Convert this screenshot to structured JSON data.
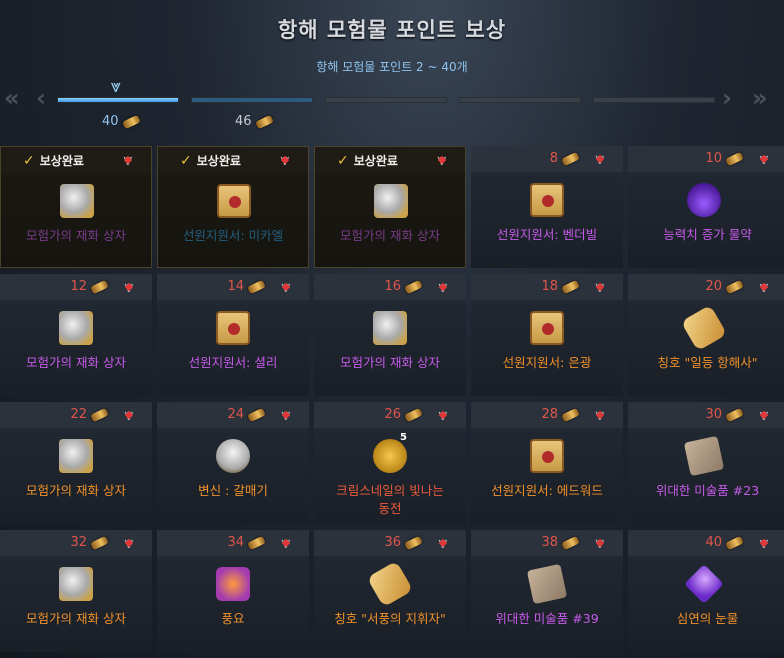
{
  "header": {
    "title": "항해 모험물 포인트 보상",
    "subtitle": "항해 모험물 포인트 2 ~ 40개"
  },
  "progress": {
    "stages": [
      {
        "points": "40",
        "fill_fraction": 1.0
      },
      {
        "points": "46",
        "fill_fraction": 1.0
      },
      {
        "points": "",
        "fill_fraction": 0
      },
      {
        "points": "",
        "fill_fraction": 0
      },
      {
        "points": "",
        "fill_fraction": 0
      }
    ]
  },
  "colors": {
    "purple": "#c65bea",
    "blue": "#2e9ad8",
    "orange": "#f0912a",
    "points_red": "#e0564a",
    "done_check": "#e8c13a"
  },
  "rewards": [
    {
      "status": "보상완료",
      "points": "",
      "icon": "chest-icon",
      "name": "모험가의 재화 상자",
      "color": "purple",
      "done": true
    },
    {
      "status": "보상완료",
      "points": "",
      "icon": "book-icon",
      "name": "선원지원서: 미카엘",
      "color": "blue",
      "done": true
    },
    {
      "status": "보상완료",
      "points": "",
      "icon": "chest-icon",
      "name": "모험가의 재화 상자",
      "color": "purple",
      "done": true
    },
    {
      "status": "",
      "points": "8",
      "icon": "book-icon",
      "name": "선원지원서: 벤더빌",
      "color": "purple",
      "done": false
    },
    {
      "status": "",
      "points": "10",
      "icon": "potion-icon",
      "name": "능력치 증가 물약",
      "color": "purple",
      "done": false
    },
    {
      "status": "",
      "points": "12",
      "icon": "chest-icon",
      "name": "모험가의 재화 상자",
      "color": "purple",
      "done": false
    },
    {
      "status": "",
      "points": "14",
      "icon": "book-icon",
      "name": "선원지원서: 셜리",
      "color": "purple",
      "done": false
    },
    {
      "status": "",
      "points": "16",
      "icon": "chest-icon",
      "name": "모험가의 재화 상자",
      "color": "purple",
      "done": false
    },
    {
      "status": "",
      "points": "18",
      "icon": "book-icon",
      "name": "선원지원서: 은광",
      "color": "orange",
      "done": false
    },
    {
      "status": "",
      "points": "20",
      "icon": "scroll-icon",
      "name": "칭호 \"일등 항해사\"",
      "color": "orange",
      "done": false
    },
    {
      "status": "",
      "points": "22",
      "icon": "chest-icon",
      "name": "모험가의 재화 상자",
      "color": "orange",
      "done": false
    },
    {
      "status": "",
      "points": "24",
      "icon": "seagull-icon",
      "name": "변신 : 갈매기",
      "color": "orange",
      "done": false
    },
    {
      "status": "",
      "points": "26",
      "icon": "coin-icon",
      "name": "크림스네일의 빛나는 동전",
      "color": "red",
      "done": false,
      "badge": "5"
    },
    {
      "status": "",
      "points": "28",
      "icon": "book-icon",
      "name": "선원지원서: 에드워드",
      "color": "orange",
      "done": false
    },
    {
      "status": "",
      "points": "30",
      "icon": "map-icon",
      "name": "위대한 미술품 #23",
      "color": "purple",
      "done": false
    },
    {
      "status": "",
      "points": "32",
      "icon": "chest-icon",
      "name": "모험가의 재화 상자",
      "color": "orange",
      "done": false
    },
    {
      "status": "",
      "points": "34",
      "icon": "music-note-icon",
      "name": "풍요",
      "color": "orange",
      "done": false
    },
    {
      "status": "",
      "points": "36",
      "icon": "scroll-icon",
      "name": "칭호 \"서풍의 지휘자\"",
      "color": "orange",
      "done": false
    },
    {
      "status": "",
      "points": "38",
      "icon": "map-icon",
      "name": "위대한 미술품 #39",
      "color": "purple",
      "done": false
    },
    {
      "status": "",
      "points": "40",
      "icon": "gem-icon",
      "name": "심연의 눈물",
      "color": "orange",
      "done": false
    }
  ]
}
